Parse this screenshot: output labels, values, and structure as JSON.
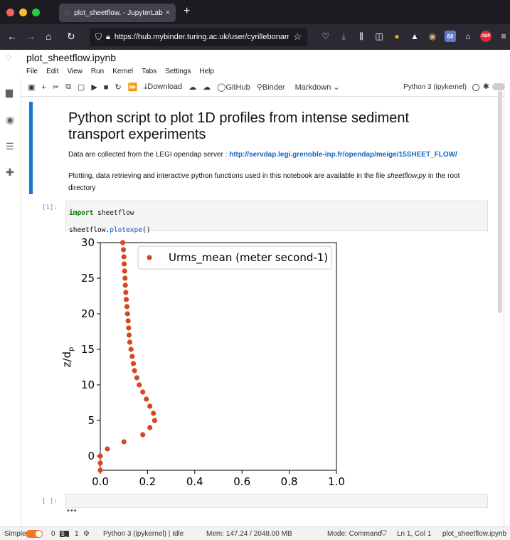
{
  "browser": {
    "tab_title": "plot_sheetflow. - JupyterLab",
    "tab_close": "×",
    "new_tab": "+",
    "url": "https://hub.mybinder.turing.ac.uk/user/cyrillebonam",
    "ext_badge": "60",
    "ext_abp": "ABP"
  },
  "jupyter": {
    "notebook_title": "plot_sheetflow.ipynb",
    "menu": [
      "File",
      "Edit",
      "View",
      "Run",
      "Kernel",
      "Tabs",
      "Settings",
      "Help"
    ],
    "toolbar": {
      "download": "Download",
      "github": "GitHub",
      "binder": "Binder",
      "cell_type": "Markdown",
      "kernel": "Python 3 (ipykernel)"
    }
  },
  "notebook": {
    "heading": "Python script to plot 1D profiles from intense sediment transport experiments",
    "p1_text": "Data are collected from the LEGI opendap server : ",
    "p1_link": "http://servdap.legi.grenoble-inp.fr/opendap/meige/15SHEET_FLOW/",
    "p2_before": "Plotting, data retrieving and interactive python functions used in this notebook are available in the file ",
    "p2_file": "sheetflow.py",
    "p2_after": " in the root directory",
    "cell1_prompt": "[1]:",
    "code_line1_kw": "import",
    "code_line1_rest": " sheetflow",
    "code_line2_obj": "sheetflow.",
    "code_line2_fn": "plotexpe",
    "code_line2_end": "()",
    "cell2_prompt": "[ ]:",
    "cell2_ellipsis": "•••"
  },
  "status": {
    "mode_label": "Simple",
    "count1": "0",
    "count2": "1",
    "kernel_status": "Python 3 (ipykernel) | Idle",
    "memory": "Mem: 147.24 / 2048.00 MB",
    "mode": "Mode: Command",
    "position": "Ln 1, Col 1",
    "file": "plot_sheetflow.ipynb"
  },
  "chart_data": {
    "type": "scatter",
    "ylabel": "z/d",
    "ylabel_sub": "p",
    "xlim": [
      0.0,
      1.0
    ],
    "ylim": [
      -2,
      30
    ],
    "xticks": [
      "0.0",
      "0.2",
      "0.4",
      "0.6",
      "0.8",
      "1.0"
    ],
    "yticks": [
      "0",
      "5",
      "10",
      "15",
      "20",
      "25",
      "30"
    ],
    "legend": "top-right",
    "color": "#d7471f",
    "series": [
      {
        "name": "Urms_mean (meter second-1)",
        "points": [
          [
            0.0,
            -2
          ],
          [
            0.0,
            -1
          ],
          [
            0.0,
            0
          ],
          [
            0.03,
            1
          ],
          [
            0.1,
            2
          ],
          [
            0.18,
            3
          ],
          [
            0.21,
            4
          ],
          [
            0.23,
            5
          ],
          [
            0.225,
            6
          ],
          [
            0.21,
            7
          ],
          [
            0.195,
            8
          ],
          [
            0.18,
            9
          ],
          [
            0.165,
            10
          ],
          [
            0.155,
            11
          ],
          [
            0.145,
            12
          ],
          [
            0.14,
            13
          ],
          [
            0.135,
            14
          ],
          [
            0.13,
            15
          ],
          [
            0.125,
            16
          ],
          [
            0.122,
            17
          ],
          [
            0.12,
            18
          ],
          [
            0.118,
            19
          ],
          [
            0.115,
            20
          ],
          [
            0.113,
            21
          ],
          [
            0.11,
            22
          ],
          [
            0.108,
            23
          ],
          [
            0.106,
            24
          ],
          [
            0.105,
            25
          ],
          [
            0.103,
            26
          ],
          [
            0.101,
            27
          ],
          [
            0.1,
            28
          ],
          [
            0.098,
            29
          ],
          [
            0.095,
            30
          ]
        ]
      }
    ]
  }
}
